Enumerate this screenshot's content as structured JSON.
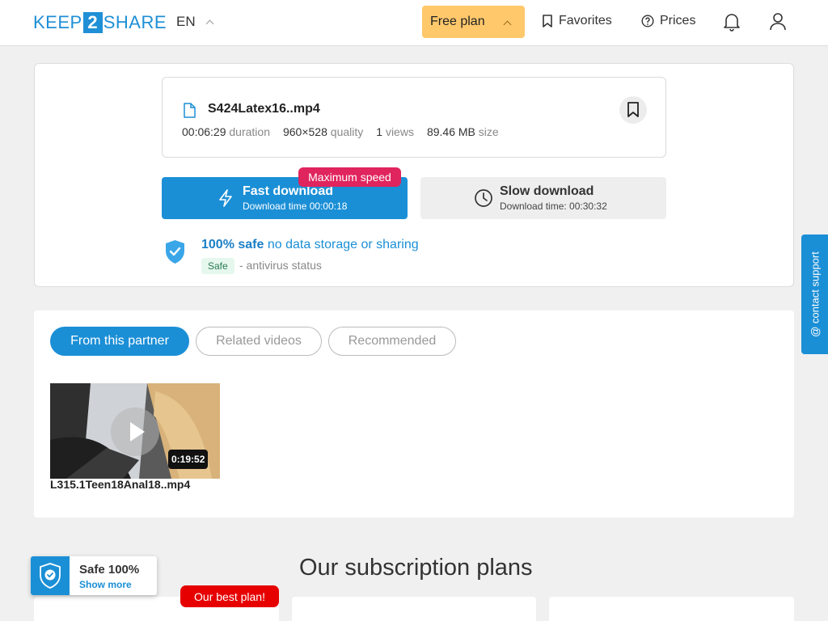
{
  "header": {
    "logo": {
      "part1": "KEEP",
      "part2": "2",
      "part3": "SHARE"
    },
    "language": "EN",
    "plan_label": "Free plan",
    "favorites_label": "Favorites",
    "prices_label": "Prices"
  },
  "file": {
    "name": "S424Latex16..mp4",
    "duration_value": "00:06:29",
    "duration_label": "duration",
    "quality_value": "960×528",
    "quality_label": "quality",
    "views_value": "1",
    "views_label": "views",
    "size_value": "89.46 MB",
    "size_label": "size"
  },
  "download": {
    "fast_title": "Fast download",
    "fast_sub": "Download time 00:00:18",
    "max_badge": "Maximum speed",
    "slow_title": "Slow download",
    "slow_sub": "Download time: 00:30:32"
  },
  "safety": {
    "bold": "100% safe",
    "text": "no data storage or sharing",
    "chip": "Safe",
    "status": "- antivirus status"
  },
  "tabs": [
    {
      "label": "From this partner"
    },
    {
      "label": "Related videos"
    },
    {
      "label": "Recommended"
    }
  ],
  "videos": [
    {
      "duration": "0:19:52",
      "title": "L315.1Teen18Anal18..mp4"
    }
  ],
  "plans": {
    "title": "Our subscription plans",
    "best_badge": "Our best plan!"
  },
  "safe_widget": {
    "title": "Safe 100%",
    "link": "Show more"
  },
  "contact": {
    "label": "@ contact support"
  },
  "colors": {
    "accent": "#1b8fd6",
    "plan": "#ffc86b",
    "badge_pink": "#e0245e",
    "badge_red": "#e60000"
  }
}
